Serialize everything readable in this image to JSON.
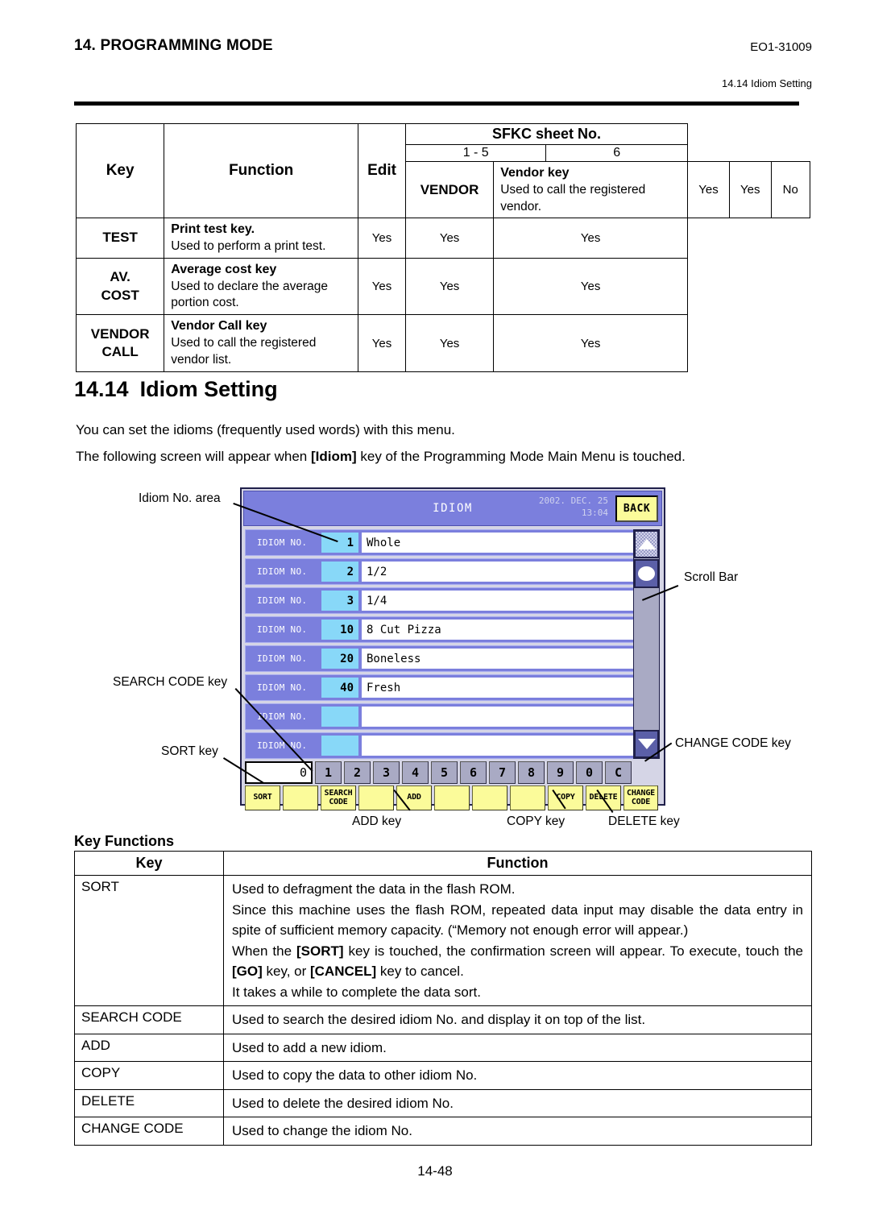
{
  "page": {
    "header_title": "14. PROGRAMMING MODE",
    "doc_code": "EO1-31009",
    "header_subtitle": "14.14 Idiom Setting",
    "footer": "14-48"
  },
  "key_table": {
    "headers": {
      "key": "Key",
      "function": "Function",
      "edit": "Edit",
      "sfkc": "SFKC sheet No.",
      "sfkc_1_5": "1 - 5",
      "sfkc_6": "6"
    },
    "rows": [
      {
        "key_lines": [
          "VENDOR"
        ],
        "fn_title": "Vendor key",
        "fn_desc": "Used to call the registered vendor.",
        "edit": "Yes",
        "s15": "Yes",
        "s6": "No"
      },
      {
        "key_lines": [
          "TEST"
        ],
        "fn_title": "Print test key.",
        "fn_desc": "Used to perform a print test.",
        "edit": "Yes",
        "s15": "Yes",
        "s6": "Yes"
      },
      {
        "key_lines": [
          "AV.",
          "COST"
        ],
        "fn_title": "Average cost key",
        "fn_desc": "Used to declare the average portion cost.",
        "edit": "Yes",
        "s15": "Yes",
        "s6": "Yes"
      },
      {
        "key_lines": [
          "VENDOR",
          "CALL"
        ],
        "fn_title": "Vendor Call key",
        "fn_desc": "Used to call the registered vendor list.",
        "edit": "Yes",
        "s15": "Yes",
        "s6": "Yes"
      }
    ]
  },
  "section": {
    "number": "14.14",
    "title": "Idiom Setting",
    "para1": "You can set the idioms (frequently used words) with this menu.",
    "para2_a": "The following screen will appear when ",
    "para2_b": "[Idiom]",
    "para2_c": " key of the Programming Mode Main Menu is touched."
  },
  "device": {
    "title": "IDIOM",
    "date": "2002. DEC. 25",
    "time": "13:04",
    "back_label": "BACK",
    "row_label": "IDIOM NO.",
    "rows": [
      {
        "no": "1",
        "text": "Whole"
      },
      {
        "no": "2",
        "text": "1/2"
      },
      {
        "no": "3",
        "text": "1/4"
      },
      {
        "no": "10",
        "text": "8 Cut Pizza"
      },
      {
        "no": "20",
        "text": "Boneless"
      },
      {
        "no": "40",
        "text": "Fresh"
      },
      {
        "no": "",
        "text": ""
      },
      {
        "no": "",
        "text": ""
      }
    ],
    "entry_value": "0",
    "numeric_keys": [
      "1",
      "2",
      "3",
      "4",
      "5",
      "6",
      "7",
      "8",
      "9",
      "0",
      "C"
    ],
    "function_keys": [
      {
        "l1": "SORT",
        "l2": ""
      },
      {
        "l1": "",
        "l2": ""
      },
      {
        "l1": "SEARCH",
        "l2": "CODE"
      },
      {
        "l1": "",
        "l2": ""
      },
      {
        "l1": "ADD",
        "l2": ""
      },
      {
        "l1": "",
        "l2": ""
      },
      {
        "l1": "",
        "l2": ""
      },
      {
        "l1": "",
        "l2": ""
      },
      {
        "l1": "COPY",
        "l2": ""
      },
      {
        "l1": "DELETE",
        "l2": ""
      },
      {
        "l1": "CHANGE",
        "l2": "CODE"
      }
    ],
    "colors": {
      "title_bar": "#7b7fdd",
      "row_label_bg": "#7b7fdd",
      "number_box_bg": "#88d8f8",
      "function_key_bg": "#fbfb9a",
      "numeric_key_bg": "#a9aac4",
      "panel_bg": "#d5d5e6"
    }
  },
  "callouts": {
    "idiom_no_area": "Idiom No. area",
    "search_code_key": "SEARCH CODE key",
    "sort_key": "SORT key",
    "scroll_bar": "Scroll Bar",
    "change_code_key": "CHANGE CODE key",
    "add_key": "ADD key",
    "copy_key": "COPY key",
    "delete_key": "DELETE key"
  },
  "key_functions": {
    "heading": "Key Functions",
    "headers": {
      "key": "Key",
      "function": "Function"
    },
    "rows": [
      {
        "key": "SORT",
        "lines": [
          {
            "text": "Used to defragment the data in the flash ROM.",
            "justify": false
          },
          {
            "text": "Since this machine uses the flash ROM, repeated data input may disable the data entry in spite of sufficient memory capacity.  (“Memory not enough error will appear.)",
            "justify": true
          },
          {
            "pre": "When the ",
            "b1": "[SORT]",
            "mid": " key is touched, the confirmation screen will appear.  To execute, touch the ",
            "b2": "[GO]",
            "mid2": " key, or ",
            "b3": "[CANCEL]",
            "post": " key to cancel.",
            "justify": true
          },
          {
            "text": "It takes a while to complete the data sort.",
            "justify": false
          }
        ]
      },
      {
        "key": "SEARCH CODE",
        "simple": "Used to search the desired idiom No. and display it on top of the list."
      },
      {
        "key": "ADD",
        "simple": "Used to add a new idiom."
      },
      {
        "key": "COPY",
        "simple": "Used to copy the data to other idiom No."
      },
      {
        "key": "DELETE",
        "simple": "Used to delete the desired idiom No."
      },
      {
        "key": "CHANGE CODE",
        "simple": "Used to change the idiom No."
      }
    ]
  }
}
